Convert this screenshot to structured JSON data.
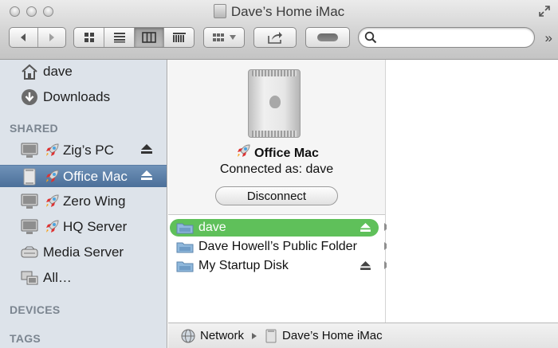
{
  "window": {
    "title": "Dave’s Home iMac"
  },
  "toolbar": {
    "search": {
      "value": "",
      "placeholder": ""
    }
  },
  "sidebar": {
    "favorites": [
      {
        "label": "dave",
        "icon": "home-icon"
      },
      {
        "label": "Downloads",
        "icon": "downloads-icon"
      }
    ],
    "shared_header": "SHARED",
    "shared": [
      {
        "label": "Zig’s PC",
        "icon": "monitor-icon",
        "ejectable": true,
        "selected": false
      },
      {
        "label": "Office Mac",
        "icon": "mac-pro-icon",
        "ejectable": true,
        "selected": true
      },
      {
        "label": "Zero Wing",
        "icon": "monitor-icon",
        "ejectable": false,
        "selected": false
      },
      {
        "label": "HQ Server",
        "icon": "monitor-icon",
        "ejectable": false,
        "selected": false
      },
      {
        "label": "Media Server",
        "icon": "media-server-icon",
        "ejectable": false,
        "selected": false
      },
      {
        "label": "All…",
        "icon": "network-computers-icon",
        "ejectable": false,
        "selected": false
      }
    ],
    "devices_header": "DEVICES",
    "tags_header": "TAGS"
  },
  "preview": {
    "name": "Office Mac",
    "status": "Connected as: dave",
    "disconnect_label": "Disconnect"
  },
  "volumes": [
    {
      "label": "dave",
      "selected": true,
      "ejectable": true
    },
    {
      "label": "Dave Howell’s Public Folder",
      "selected": false,
      "ejectable": false
    },
    {
      "label": "My Startup Disk",
      "selected": false,
      "ejectable": true
    }
  ],
  "pathbar": [
    {
      "label": "Network",
      "icon": "network-globe-icon"
    },
    {
      "label": "Dave’s Home iMac",
      "icon": "computer-icon"
    }
  ],
  "colors": {
    "sidebar_bg": "#dde3ea",
    "sidebar_selected": "#4b6f99",
    "volume_selected": "#5fc05a",
    "section_header": "#7b8590"
  }
}
